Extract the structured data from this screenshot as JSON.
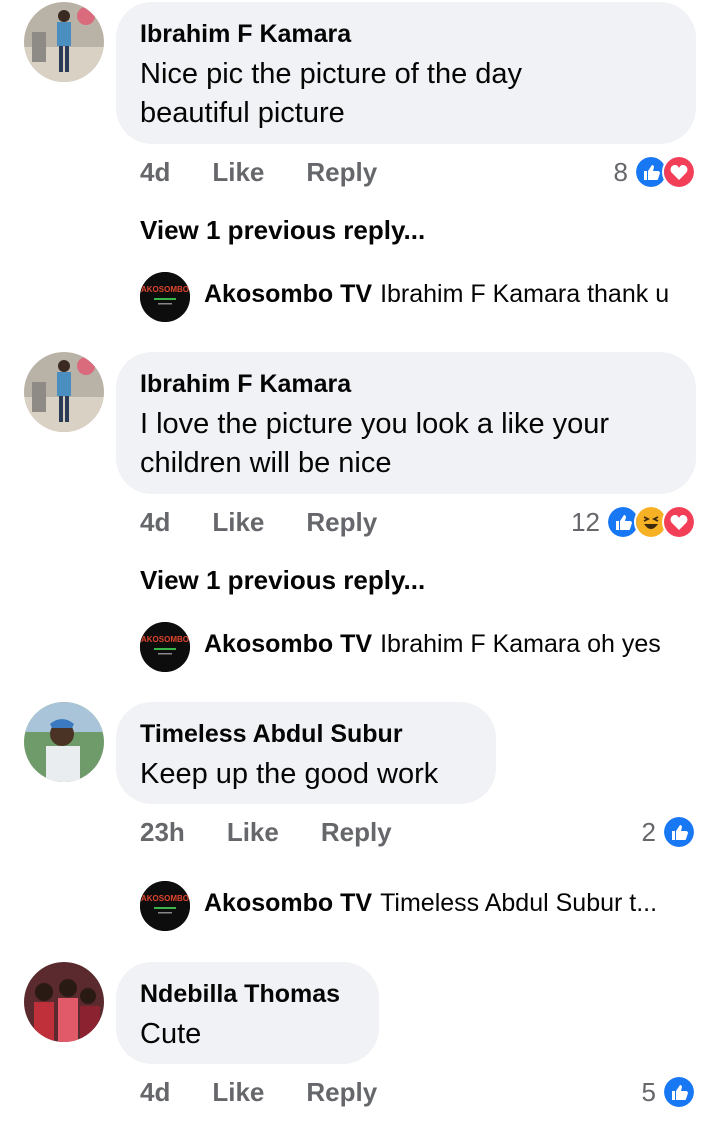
{
  "comments": [
    {
      "name": "Ibrahim F Kamara",
      "text_lines": [
        "Nice pic the picture of the day",
        "beautiful picture"
      ],
      "time": "4d",
      "like": "Like",
      "reply": "Reply",
      "reaction_count": "8",
      "reactions": [
        "like-icon",
        "love-icon"
      ],
      "view_previous": "View 1 previous reply...",
      "reply_item": {
        "name": "Akosombo TV",
        "text": "Ibrahim F Kamara thank u"
      }
    },
    {
      "name": "Ibrahim F Kamara",
      "text_lines": [
        "I love the picture you look a like your",
        "children will be nice"
      ],
      "time": "4d",
      "like": "Like",
      "reply": "Reply",
      "reaction_count": "12",
      "reactions": [
        "like-icon",
        "haha-icon",
        "love-icon"
      ],
      "view_previous": "View 1 previous reply...",
      "reply_item": {
        "name": "Akosombo TV",
        "text": "Ibrahim F Kamara oh yes"
      }
    },
    {
      "name": "Timeless Abdul Subur",
      "text_lines": [
        "Keep up the good work"
      ],
      "time": "23h",
      "like": "Like",
      "reply": "Reply",
      "reaction_count": "2",
      "reactions": [
        "like-icon"
      ],
      "reply_item": {
        "name": "Akosombo TV",
        "text": "Timeless Abdul Subur t..."
      }
    },
    {
      "name": "Ndebilla Thomas",
      "text_lines": [
        "Cute"
      ],
      "time": "4d",
      "like": "Like",
      "reply": "Reply",
      "reaction_count": "5",
      "reactions": [
        "like-icon"
      ]
    }
  ],
  "colors": {
    "like_blue": "#1877f2",
    "love_red": "#f33e58",
    "haha_yellow": "#f7b125",
    "meta_gray": "#65676b",
    "bubble_bg": "#f0f2f5"
  },
  "logo_text": "AKOSOMBO"
}
